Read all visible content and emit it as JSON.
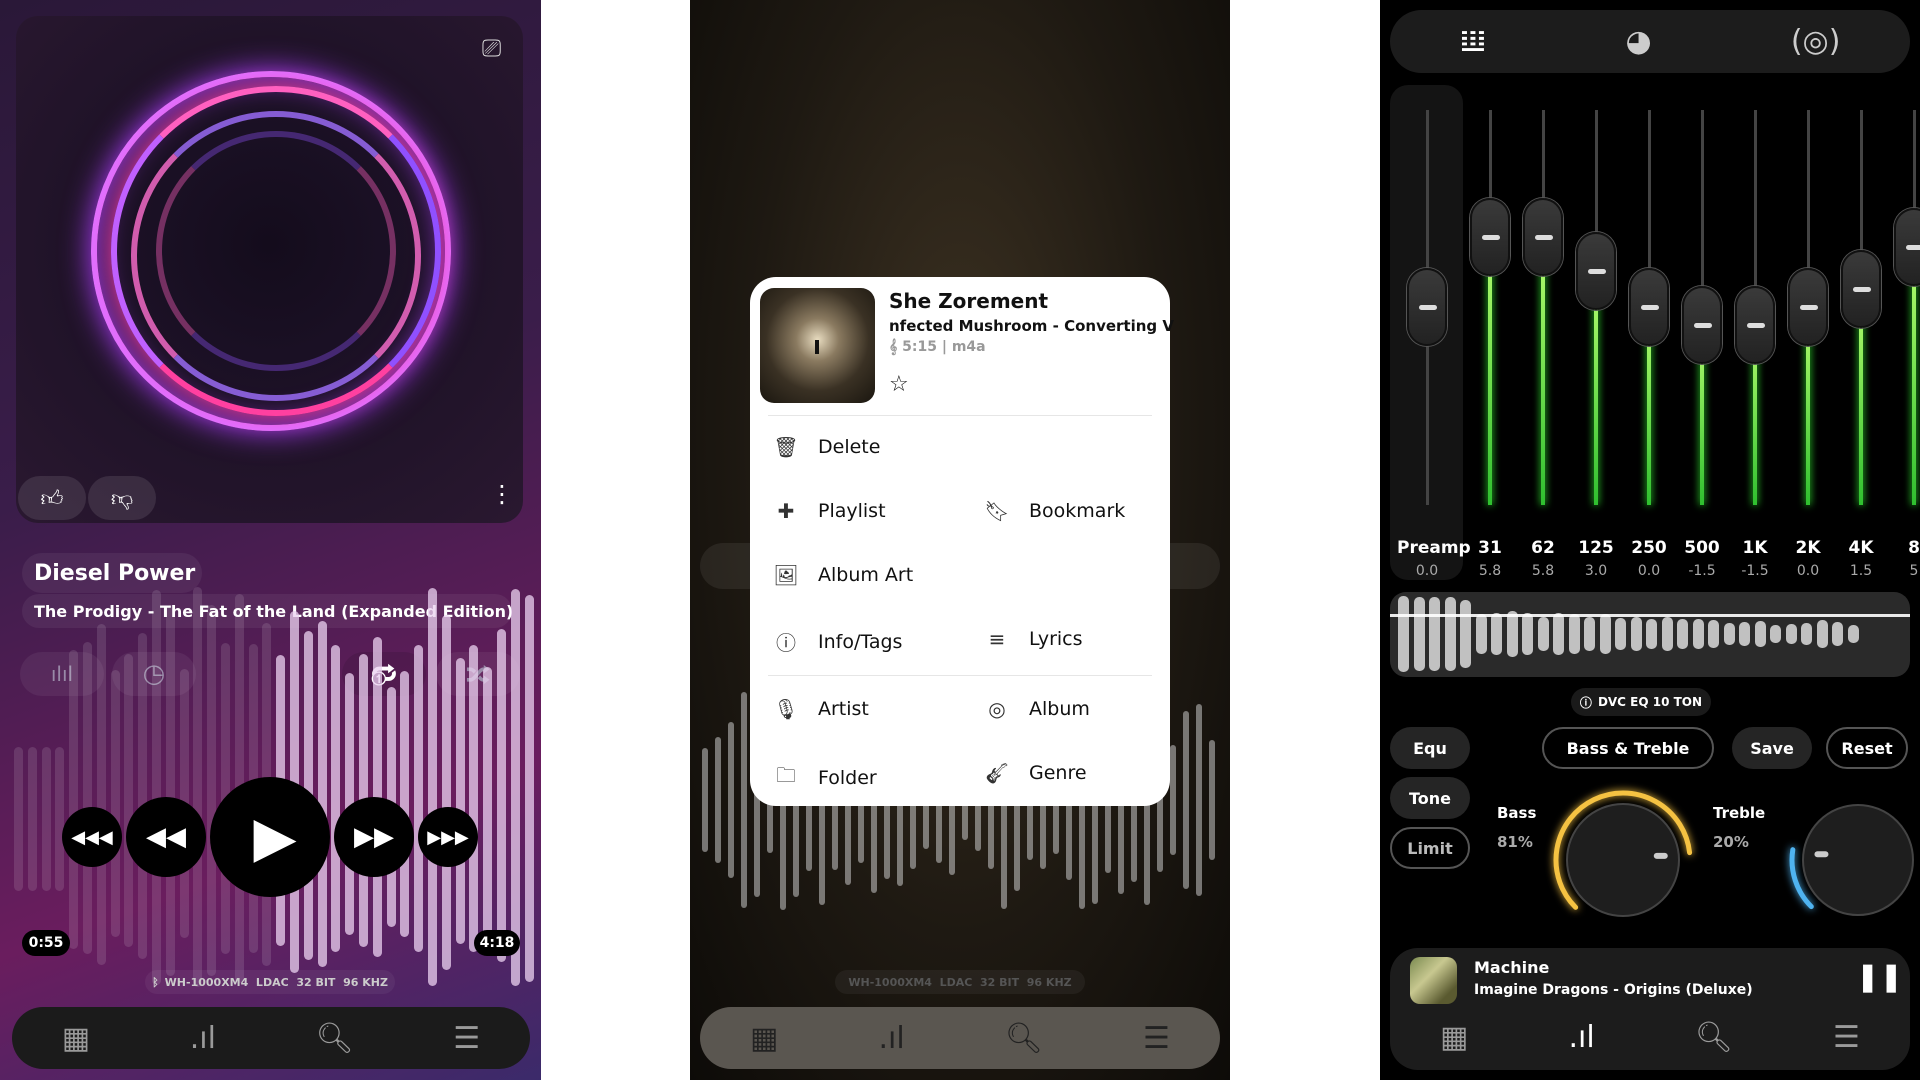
{
  "player": {
    "song_title": "Diesel Power",
    "song_subtitle": "The Prodigy - The Fat of the Land (Expanded Edition)",
    "elapsed": "0:55",
    "duration": "4:18",
    "device_info": "WH-1000XM4  LDAC  32 BIT  96 KHZ",
    "repeat_mode": "repeat-one",
    "waveform_played_fraction": 0.5,
    "icons": [
      "cast-icon",
      "thumbs-up-icon",
      "thumbs-down-icon",
      "more-vert-icon",
      "visualizer-icon",
      "sleep-timer-icon",
      "repeat-one-icon",
      "shuffle-icon"
    ]
  },
  "context_menu": {
    "title": "She Zorement",
    "subtitle": "nfected Mushroom - Converting V",
    "meta": "5:15 | m4a",
    "items": {
      "delete": "Delete",
      "playlist": "Playlist",
      "bookmark": "Bookmark",
      "album_art": "Album Art",
      "info_tags": "Info/Tags",
      "lyrics": "Lyrics",
      "artist": "Artist",
      "album": "Album",
      "folder": "Folder",
      "genre": "Genre"
    },
    "background_device_info": "WH-1000XM4  LDAC  32 BIT  96 KHZ"
  },
  "equalizer": {
    "preamp": {
      "label": "Preamp",
      "value": "0.0"
    },
    "bands": [
      {
        "label": "31",
        "value": "5.8"
      },
      {
        "label": "62",
        "value": "5.8"
      },
      {
        "label": "125",
        "value": "3.0"
      },
      {
        "label": "250",
        "value": "0.0"
      },
      {
        "label": "500",
        "value": "-1.5"
      },
      {
        "label": "1K",
        "value": "-1.5"
      },
      {
        "label": "2K",
        "value": "0.0"
      },
      {
        "label": "4K",
        "value": "1.5"
      },
      {
        "label": "8",
        "value": "5"
      }
    ],
    "preset": "DVC EQ 10 TON",
    "buttons": {
      "equ": "Equ",
      "tone": "Tone",
      "limit": "Limit",
      "bass_treble": "Bass & Treble",
      "save": "Save",
      "reset": "Reset"
    },
    "bass": {
      "label": "Bass",
      "value": "81%",
      "level": 81,
      "color": "#f5c242"
    },
    "treble": {
      "label": "Treble",
      "value": "20%",
      "level": 20,
      "color": "#4fb3f0"
    },
    "mini_player": {
      "title": "Machine",
      "subtitle": "Imagine Dragons - Origins (Deluxe)"
    }
  },
  "nav": [
    "library-icon",
    "equalizer-icon",
    "search-icon",
    "queue-icon"
  ],
  "colors": {
    "eq_green": "#3fdc3f",
    "bass_arc": "#f5c242",
    "treble_arc": "#4fb3f0"
  }
}
